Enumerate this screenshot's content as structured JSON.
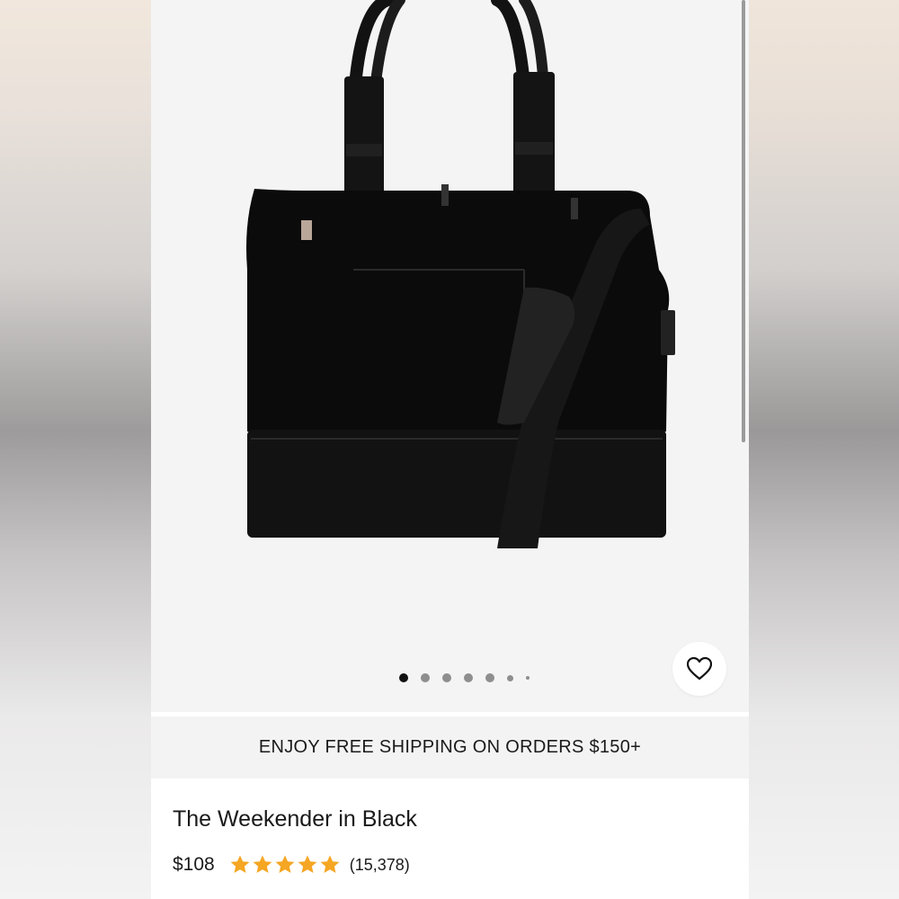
{
  "product": {
    "image_name": "weekender-bag-black-photo",
    "image_count": 7,
    "active_image_index": 0,
    "favorite_icon": "heart-icon"
  },
  "banner": {
    "text": "ENJOY FREE SHIPPING ON ORDERS $150+"
  },
  "details": {
    "title": "The Weekender in Black",
    "price": "$108",
    "rating": 5,
    "rating_icon": "star-icon",
    "rating_color": "#f5a623",
    "review_count": "(15,378)"
  }
}
